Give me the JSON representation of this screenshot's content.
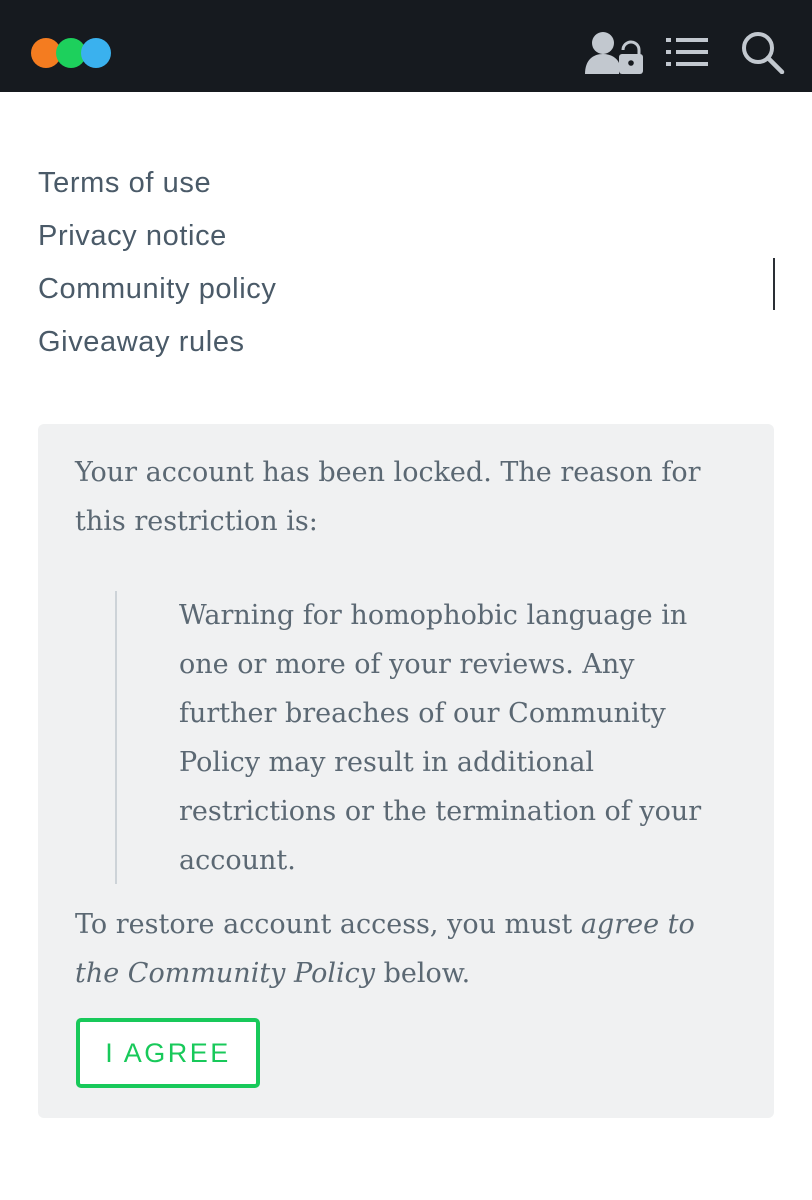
{
  "header": {
    "logo_colors": [
      "#f47c20",
      "#1dd05c",
      "#3ab1ee"
    ],
    "icons": [
      "account-lock-icon",
      "list-icon",
      "search-icon"
    ]
  },
  "footer_links": [
    "Terms of use",
    "Privacy notice",
    "Community policy",
    "Giveaway rules"
  ],
  "notice": {
    "intro": "Your account has been locked. The reason for this restriction is:",
    "reason": "Warning for homophobic language in one or more of your reviews. Any further breaches of our Community Policy may result in additional restrictions or the termination of your account.",
    "restore_prefix": "To restore account access, you must ",
    "restore_emphasis": "agree to the Community Policy",
    "restore_suffix": " below.",
    "button_label": "I AGREE"
  },
  "colors": {
    "header_bg": "#161a1f",
    "accent_green": "#18c95a",
    "panel_bg": "#f0f1f2",
    "link_text": "#4a5a68"
  }
}
